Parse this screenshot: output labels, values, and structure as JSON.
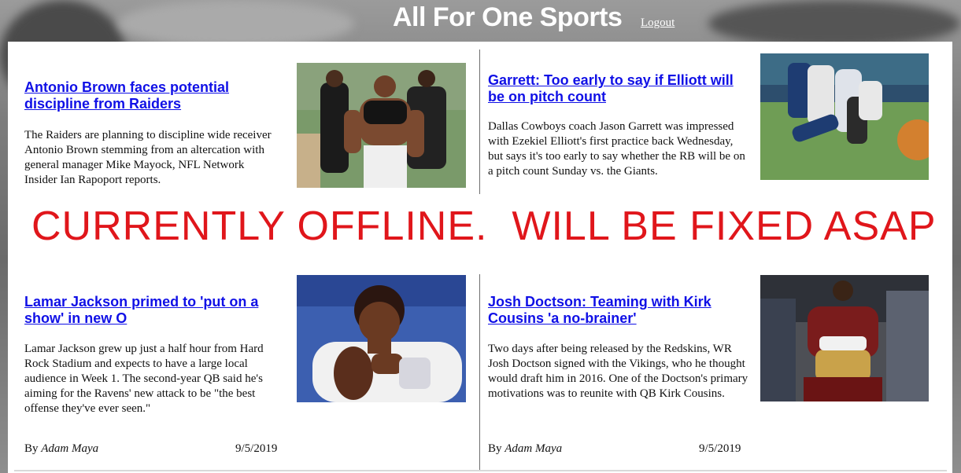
{
  "header": {
    "title": "All For One Sports",
    "logout_label": "Logout"
  },
  "banner": {
    "text": "CURRENTLY OFFLINE.  WILL BE FIXED ASAP",
    "color": "#e0161b"
  },
  "articles": [
    {
      "title": "Antonio Brown faces potential discipline from Raiders",
      "body": "The Raiders are planning to discipline wide receiver Antonio Brown stemming from an altercation with general manager Mike Mayock, NFL Network Insider Ian Rapoport reports.",
      "image": "antonio-brown-photo"
    },
    {
      "title": "Garrett: Too early to say if Elliott will be on pitch count",
      "body": "Dallas Cowboys coach Jason Garrett was impressed with Ezekiel Elliott's first practice back Wednesday, but says it's too early to say whether the RB will be on a pitch count Sunday vs. the Giants.",
      "image": "cowboys-practice-photo"
    },
    {
      "title": "Lamar Jackson primed to 'put on a show' in new O",
      "body": "Lamar Jackson grew up just a half hour from Hard Rock Stadium and expects to have a large local audience in Week 1. The second-year QB said he's aiming for the Ravens' new attack to be \"the best offense they've ever seen.\"",
      "image": "lamar-jackson-photo",
      "byline_prefix": "By",
      "author": "Adam Maya",
      "date": "9/5/2019"
    },
    {
      "title": "Josh Doctson: Teaming with Kirk Cousins 'a no-brainer'",
      "body": "Two days after being released by the Redskins, WR Josh Doctson signed with the Vikings, who he thought would draft him in 2016. One of the Doctson's primary motivations was to reunite with QB Kirk Cousins.",
      "image": "josh-doctson-photo",
      "byline_prefix": "By",
      "author": "Adam Maya",
      "date": "9/5/2019"
    }
  ],
  "colors": {
    "link": "#1010e6",
    "panel": "#ffffff"
  }
}
